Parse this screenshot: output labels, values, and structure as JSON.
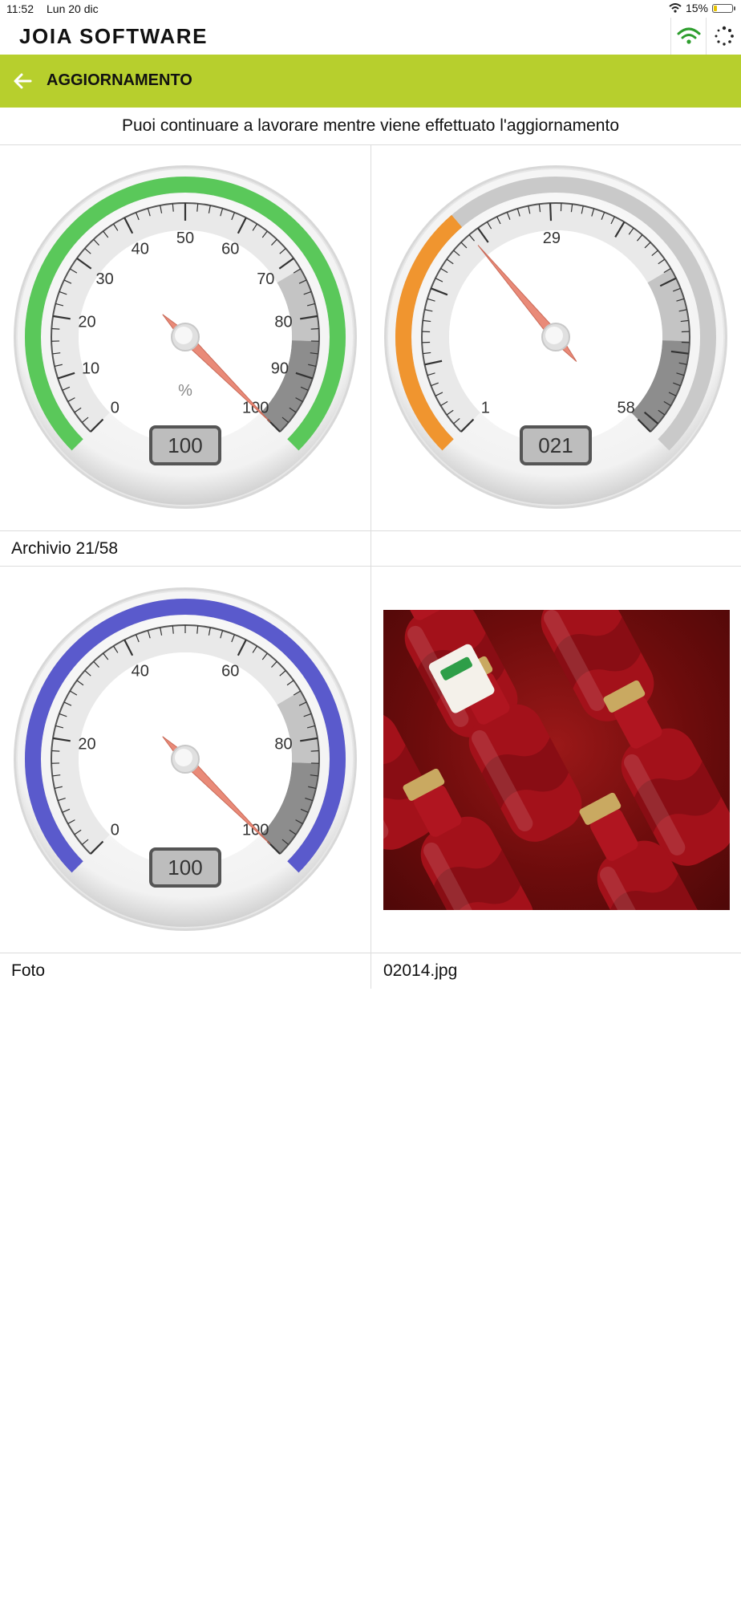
{
  "status_bar": {
    "time": "11:52",
    "date": "Lun 20 dic",
    "battery": "15%",
    "battery_level": 0.15
  },
  "app": {
    "title": "JOIA SOFTWARE",
    "wifi_icon": "wifi-icon",
    "sync_icon": "sync-spinner-icon"
  },
  "toolbar": {
    "back_icon": "arrow-left-icon",
    "title": "AGGIORNAMENTO",
    "color": "#b7cf2d"
  },
  "info_message": "Puoi continuare a lavorare mentre viene effettuato l'aggiornamento",
  "gauges": [
    {
      "id": "progress",
      "min": 0,
      "max": 100,
      "value": 100,
      "display": "100",
      "labels": [
        "0",
        "10",
        "20",
        "30",
        "40",
        "50",
        "60",
        "70",
        "80",
        "90",
        "100"
      ],
      "unit": "%",
      "arc_color": "#5ac85a",
      "arc_fraction": 1.0
    },
    {
      "id": "files",
      "min": 1,
      "max": 58,
      "value": 21,
      "display": "021",
      "labels": [
        "1",
        "29",
        "58"
      ],
      "unit": "",
      "arc_color": "#f0952f",
      "arc_fraction": 0.35
    },
    {
      "id": "photos",
      "min": 0,
      "max": 100,
      "value": 100,
      "display": "100",
      "labels": [
        "0",
        "20",
        "40",
        "60",
        "80",
        "100"
      ],
      "unit": "",
      "arc_color": "#5a5acc",
      "arc_fraction": 1.0
    }
  ],
  "rows": [
    {
      "left_label": "Archivio 21/58",
      "right_label": ""
    },
    {
      "left_label": "Foto",
      "right_label": "02014.jpg"
    }
  ],
  "photo": {
    "subject": "red sauce bottles",
    "background": "#7a0f0f"
  }
}
